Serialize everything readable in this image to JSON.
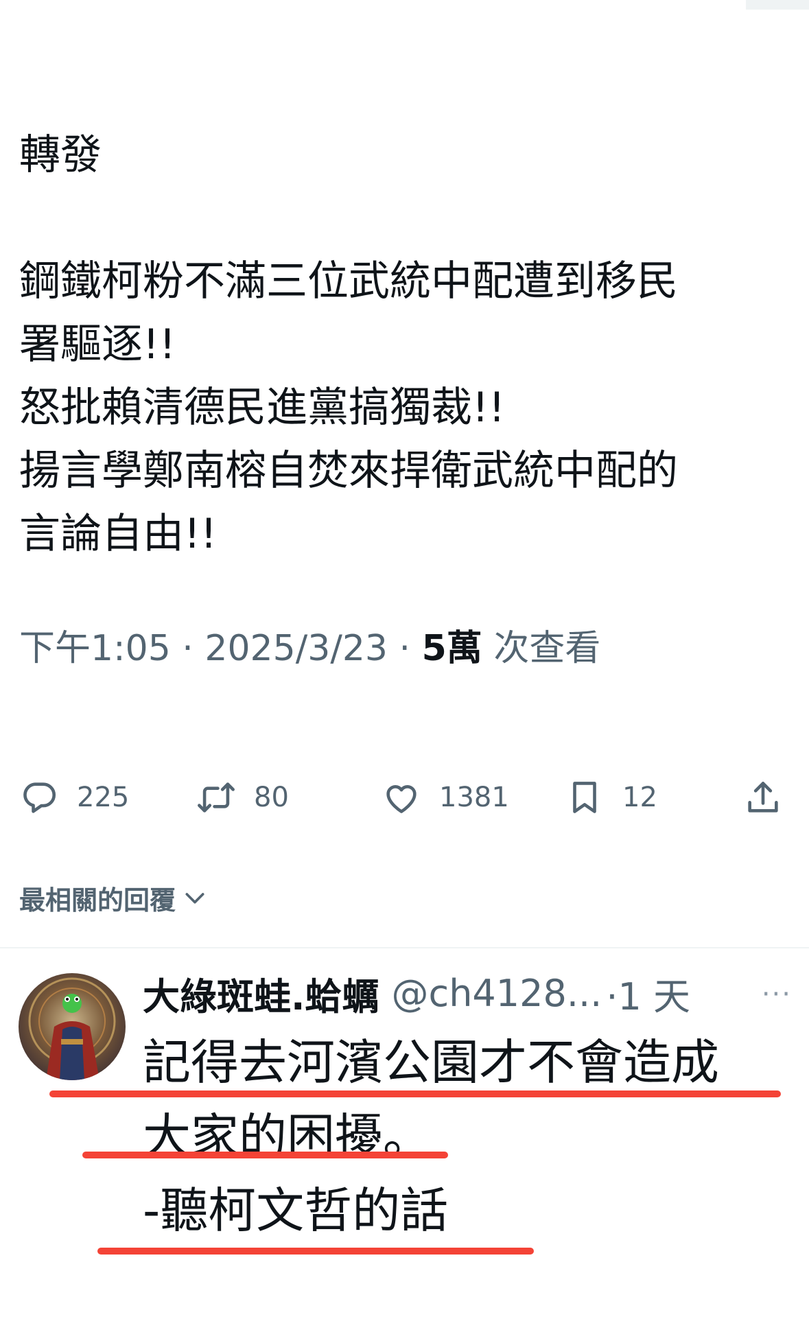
{
  "post": {
    "lines": [
      "轉發",
      "鋼鐵柯粉不滿三位武統中配遭到移民",
      "署驅逐!!",
      "怒批賴清德民進黨搞獨裁!!",
      "揚言學鄭南榕自焚來捍衛武統中配的",
      "言論自由!!"
    ],
    "time": "下午1:05",
    "separator": " · ",
    "date": "2025/3/23",
    "views_count": "5萬",
    "views_label": " 次查看"
  },
  "actions": {
    "replies": "225",
    "retweets": "80",
    "likes": "1381",
    "bookmarks": "12"
  },
  "replies_sort": {
    "label": "最相關的回覆"
  },
  "reply": {
    "name": "大綠斑蛙.蛤蠣",
    "handle": "@ch4128...",
    "time": "·1 天",
    "more": "···",
    "lines": [
      "記得去河濱公園才不會造成",
      "大家的困擾。",
      "-聽柯文哲的話"
    ]
  },
  "colors": {
    "text_primary": "#0f1419",
    "text_secondary": "#536471",
    "divider": "#eff3f4",
    "annotation_red": "#f44336"
  },
  "icons": [
    "reply-icon",
    "retweet-icon",
    "like-icon",
    "bookmark-icon",
    "share-icon",
    "chevron-down-icon",
    "more-icon"
  ]
}
